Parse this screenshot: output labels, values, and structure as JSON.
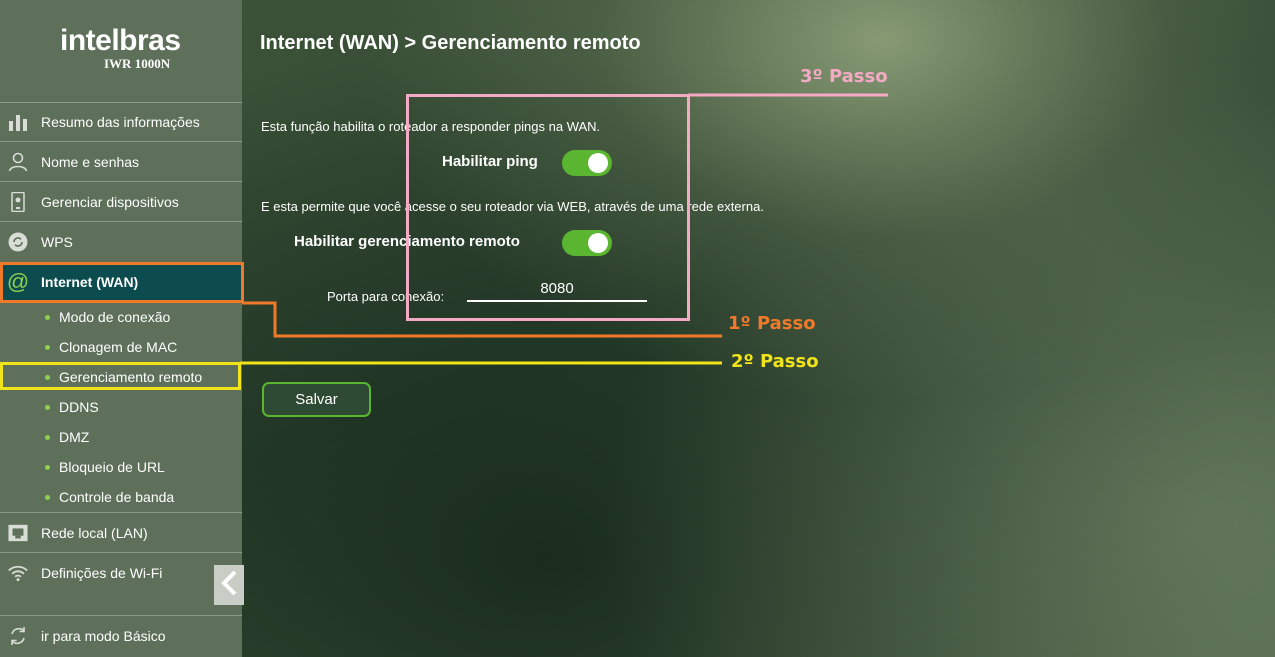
{
  "brand": {
    "logo": "intelbras",
    "model": "IWR 1000N"
  },
  "sidebar": {
    "items": [
      {
        "label": "Resumo das informações",
        "icon": "bar-chart-icon"
      },
      {
        "label": "Nome e senhas",
        "icon": "user-icon"
      },
      {
        "label": "Gerenciar dispositivos",
        "icon": "device-icon"
      },
      {
        "label": "WPS",
        "icon": "wps-icon"
      },
      {
        "label": "Internet (WAN)",
        "icon": "at-icon",
        "active": true
      },
      {
        "label": "Rede local (LAN)",
        "icon": "ethernet-icon"
      },
      {
        "label": "Definições de Wi-Fi",
        "icon": "wifi-icon"
      },
      {
        "label": "ir para modo Básico",
        "icon": "swap-icon"
      }
    ],
    "subitems": [
      {
        "label": "Modo de conexão"
      },
      {
        "label": "Clonagem de MAC"
      },
      {
        "label": "Gerenciamento remoto",
        "selected": true
      },
      {
        "label": "DDNS"
      },
      {
        "label": "DMZ"
      },
      {
        "label": "Bloqueio de URL"
      },
      {
        "label": "Controle de banda"
      }
    ]
  },
  "main": {
    "title": "Internet (WAN) > Gerenciamento remoto",
    "ping_description": "Esta função habilita o roteador a responder pings na WAN.",
    "ping_label": "Habilitar ping",
    "ping_enabled": true,
    "remote_description": "E esta permite que você acesse o seu roteador via WEB, através de uma rede externa.",
    "remote_label": "Habilitar gerenciamento remoto",
    "remote_enabled": true,
    "port_label": "Porta para conexão:",
    "port_value": "8080",
    "save_label": "Salvar"
  },
  "annotations": {
    "step1": {
      "label": "1º Passo",
      "color": "#f0792a"
    },
    "step2": {
      "label": "2º Passo",
      "color": "#f2e41a"
    },
    "step3": {
      "label": "3º Passo",
      "color": "#f4a9c4"
    }
  },
  "colors": {
    "sidebar": "#5e6f5a",
    "active": "#0d4c4e",
    "accent_green": "#5ab531"
  }
}
